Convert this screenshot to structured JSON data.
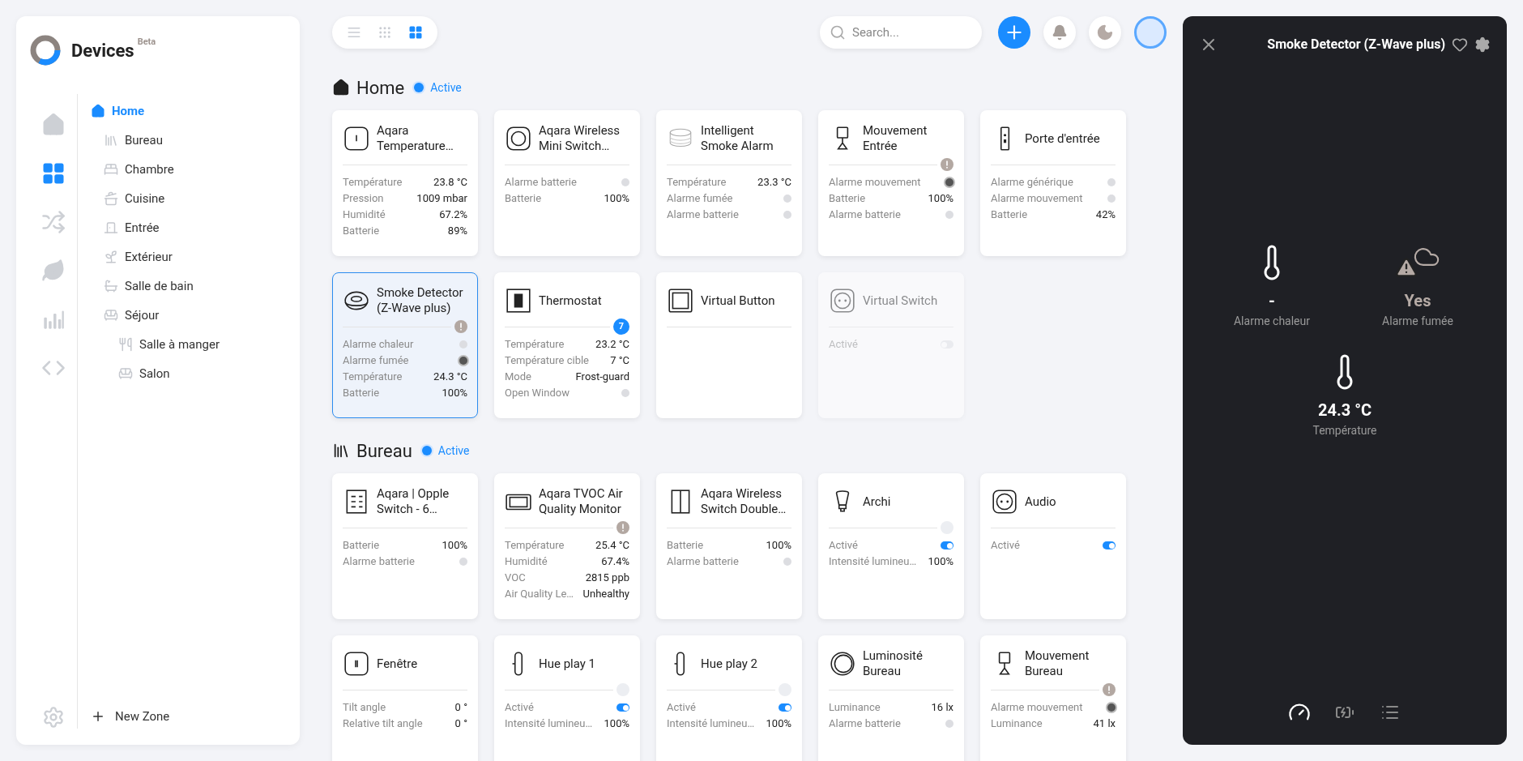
{
  "app": {
    "title": "Devices",
    "badge": "Beta"
  },
  "rail": [
    {
      "selected": false
    },
    {
      "selected": true
    },
    {
      "selected": false
    },
    {
      "selected": false
    },
    {
      "selected": false
    },
    {
      "selected": false
    }
  ],
  "zones": [
    {
      "label": "Home",
      "selected": true,
      "children": [
        {
          "label": "Bureau",
          "selected": false
        },
        {
          "label": "Chambre",
          "selected": false
        },
        {
          "label": "Cuisine",
          "selected": false
        },
        {
          "label": "Entrée",
          "selected": false
        },
        {
          "label": "Extérieur",
          "selected": false
        },
        {
          "label": "Salle de bain",
          "selected": false
        },
        {
          "label": "Séjour",
          "selected": false,
          "children": [
            {
              "label": "Salle à manger",
              "selected": false
            },
            {
              "label": "Salon",
              "selected": false
            }
          ]
        }
      ]
    }
  ],
  "new_zone": "New Zone",
  "view_modes": [
    {
      "selected": false
    },
    {
      "selected": false
    },
    {
      "selected": true
    }
  ],
  "search": {
    "placeholder": "Search..."
  },
  "sections": [
    {
      "title": "Home",
      "status": "Active",
      "cards": [
        {
          "title": "Aqara Temperature…",
          "selected": false,
          "disabled": false,
          "badge": {
            "kind": "none"
          },
          "rows": [
            {
              "kind": "value",
              "label": "Température",
              "value": "23.8 °C"
            },
            {
              "kind": "value",
              "label": "Pression",
              "value": "1009 mbar"
            },
            {
              "kind": "value",
              "label": "Humidité",
              "value": "67.2%"
            },
            {
              "kind": "value",
              "label": "Batterie",
              "value": "89%"
            }
          ]
        },
        {
          "title": "Aqara Wireless Mini Switch…",
          "selected": false,
          "disabled": false,
          "badge": {
            "kind": "none"
          },
          "rows": [
            {
              "kind": "dot",
              "label": "Alarme batterie",
              "on": false
            },
            {
              "kind": "value",
              "label": "Batterie",
              "value": "100%"
            }
          ]
        },
        {
          "title": "Intelligent Smoke Alarm",
          "selected": false,
          "disabled": false,
          "badge": {
            "kind": "none"
          },
          "rows": [
            {
              "kind": "value",
              "label": "Température",
              "value": "23.3 °C"
            },
            {
              "kind": "dot",
              "label": "Alarme fumée",
              "on": false
            },
            {
              "kind": "dot",
              "label": "Alarme batterie",
              "on": false
            }
          ]
        },
        {
          "title": "Mouvement Entrée",
          "selected": false,
          "disabled": false,
          "badge": {
            "kind": "alert"
          },
          "rows": [
            {
              "kind": "dot",
              "label": "Alarme mouvement",
              "on": true
            },
            {
              "kind": "value",
              "label": "Batterie",
              "value": "100%"
            },
            {
              "kind": "dot",
              "label": "Alarme batterie",
              "on": false
            }
          ]
        },
        {
          "title": "Porte d'entrée",
          "selected": false,
          "disabled": false,
          "badge": {
            "kind": "none"
          },
          "rows": [
            {
              "kind": "dot",
              "label": "Alarme générique",
              "on": false
            },
            {
              "kind": "dot",
              "label": "Alarme mouvement",
              "on": false
            },
            {
              "kind": "value",
              "label": "Batterie",
              "value": "42%"
            }
          ]
        },
        {
          "title": "Smoke Detector (Z-Wave plus)",
          "selected": true,
          "disabled": false,
          "badge": {
            "kind": "alert"
          },
          "rows": [
            {
              "kind": "dot",
              "label": "Alarme chaleur",
              "on": false
            },
            {
              "kind": "dot",
              "label": "Alarme fumée",
              "on": true
            },
            {
              "kind": "value",
              "label": "Température",
              "value": "24.3 °C"
            },
            {
              "kind": "value",
              "label": "Batterie",
              "value": "100%"
            }
          ]
        },
        {
          "title": "Thermostat",
          "selected": false,
          "disabled": false,
          "badge": {
            "kind": "count",
            "text": "7"
          },
          "rows": [
            {
              "kind": "value",
              "label": "Température",
              "value": "23.2 °C"
            },
            {
              "kind": "value",
              "label": "Température cible",
              "value": "7 °C"
            },
            {
              "kind": "value",
              "label": "Mode",
              "value": "Frost-guard"
            },
            {
              "kind": "dot",
              "label": "Open Window",
              "on": false
            }
          ]
        },
        {
          "title": "Virtual Button",
          "selected": false,
          "disabled": false,
          "badge": {
            "kind": "none"
          }
        },
        {
          "title": "Virtual Switch",
          "selected": false,
          "disabled": true,
          "badge": {
            "kind": "none"
          },
          "rows": [
            {
              "kind": "toggle",
              "label": "Activé",
              "on": false
            }
          ]
        }
      ]
    },
    {
      "title": "Bureau",
      "status": "Active",
      "cards": [
        {
          "title": "Aqara | Opple Switch - 6…",
          "selected": false,
          "disabled": false,
          "badge": {
            "kind": "none"
          },
          "rows": [
            {
              "kind": "value",
              "label": "Batterie",
              "value": "100%"
            },
            {
              "kind": "dot",
              "label": "Alarme batterie",
              "on": false
            }
          ]
        },
        {
          "title": "Aqara TVOC Air Quality Monitor",
          "selected": false,
          "disabled": false,
          "badge": {
            "kind": "alert"
          },
          "rows": [
            {
              "kind": "value",
              "label": "Température",
              "value": "25.4 °C"
            },
            {
              "kind": "value",
              "label": "Humidité",
              "value": "67.4%"
            },
            {
              "kind": "value",
              "label": "VOC",
              "value": "2815 ppb"
            },
            {
              "kind": "value",
              "label": "Air Quality Le…",
              "value": "Unhealthy"
            }
          ]
        },
        {
          "title": "Aqara Wireless Switch Double…",
          "selected": false,
          "disabled": false,
          "badge": {
            "kind": "none"
          },
          "rows": [
            {
              "kind": "value",
              "label": "Batterie",
              "value": "100%"
            },
            {
              "kind": "dot",
              "label": "Alarme batterie",
              "on": false
            }
          ]
        },
        {
          "title": "Archi",
          "selected": false,
          "disabled": false,
          "badge": {
            "kind": "idle"
          },
          "rows": [
            {
              "kind": "toggle",
              "label": "Activé",
              "on": true
            },
            {
              "kind": "value",
              "label": "Intensité lumineu…",
              "value": "100%"
            }
          ]
        },
        {
          "title": "Audio",
          "selected": false,
          "disabled": false,
          "badge": {
            "kind": "none"
          },
          "rows": [
            {
              "kind": "toggle",
              "label": "Activé",
              "on": true
            }
          ]
        },
        {
          "title": "Fenêtre",
          "selected": false,
          "disabled": false,
          "badge": {
            "kind": "none"
          },
          "rows": [
            {
              "kind": "value",
              "label": "Tilt angle",
              "value": "0 °"
            },
            {
              "kind": "value",
              "label": "Relative tilt angle",
              "value": "0 °"
            }
          ]
        },
        {
          "title": "Hue play 1",
          "selected": false,
          "disabled": false,
          "badge": {
            "kind": "idle"
          },
          "rows": [
            {
              "kind": "toggle",
              "label": "Activé",
              "on": true
            },
            {
              "kind": "value",
              "label": "Intensité lumineu…",
              "value": "100%"
            }
          ]
        },
        {
          "title": "Hue play 2",
          "selected": false,
          "disabled": false,
          "badge": {
            "kind": "idle"
          },
          "rows": [
            {
              "kind": "toggle",
              "label": "Activé",
              "on": true
            },
            {
              "kind": "value",
              "label": "Intensité lumineu…",
              "value": "100%"
            }
          ]
        },
        {
          "title": "Luminosité Bureau",
          "selected": false,
          "disabled": false,
          "badge": {
            "kind": "none"
          },
          "rows": [
            {
              "kind": "value",
              "label": "Luminance",
              "value": "16 lx"
            },
            {
              "kind": "dot",
              "label": "Alarme batterie",
              "on": false
            }
          ]
        },
        {
          "title": "Mouvement Bureau",
          "selected": false,
          "disabled": false,
          "badge": {
            "kind": "alert"
          },
          "rows": [
            {
              "kind": "dot",
              "label": "Alarme mouvement",
              "on": true
            },
            {
              "kind": "value",
              "label": "Luminance",
              "value": "41 lx"
            }
          ]
        }
      ]
    }
  ],
  "panel": {
    "title": "Smoke Detector (Z-Wave plus)",
    "states": [
      {
        "value": "-",
        "label": "Alarme chaleur",
        "alert": false
      },
      {
        "value": "Yes",
        "label": "Alarme fumée",
        "alert": true
      },
      {
        "value": "24.3 °C",
        "label": "Température",
        "alert": false
      }
    ],
    "tabs": [
      {
        "selected": true
      },
      {
        "selected": false
      },
      {
        "selected": false
      }
    ]
  }
}
